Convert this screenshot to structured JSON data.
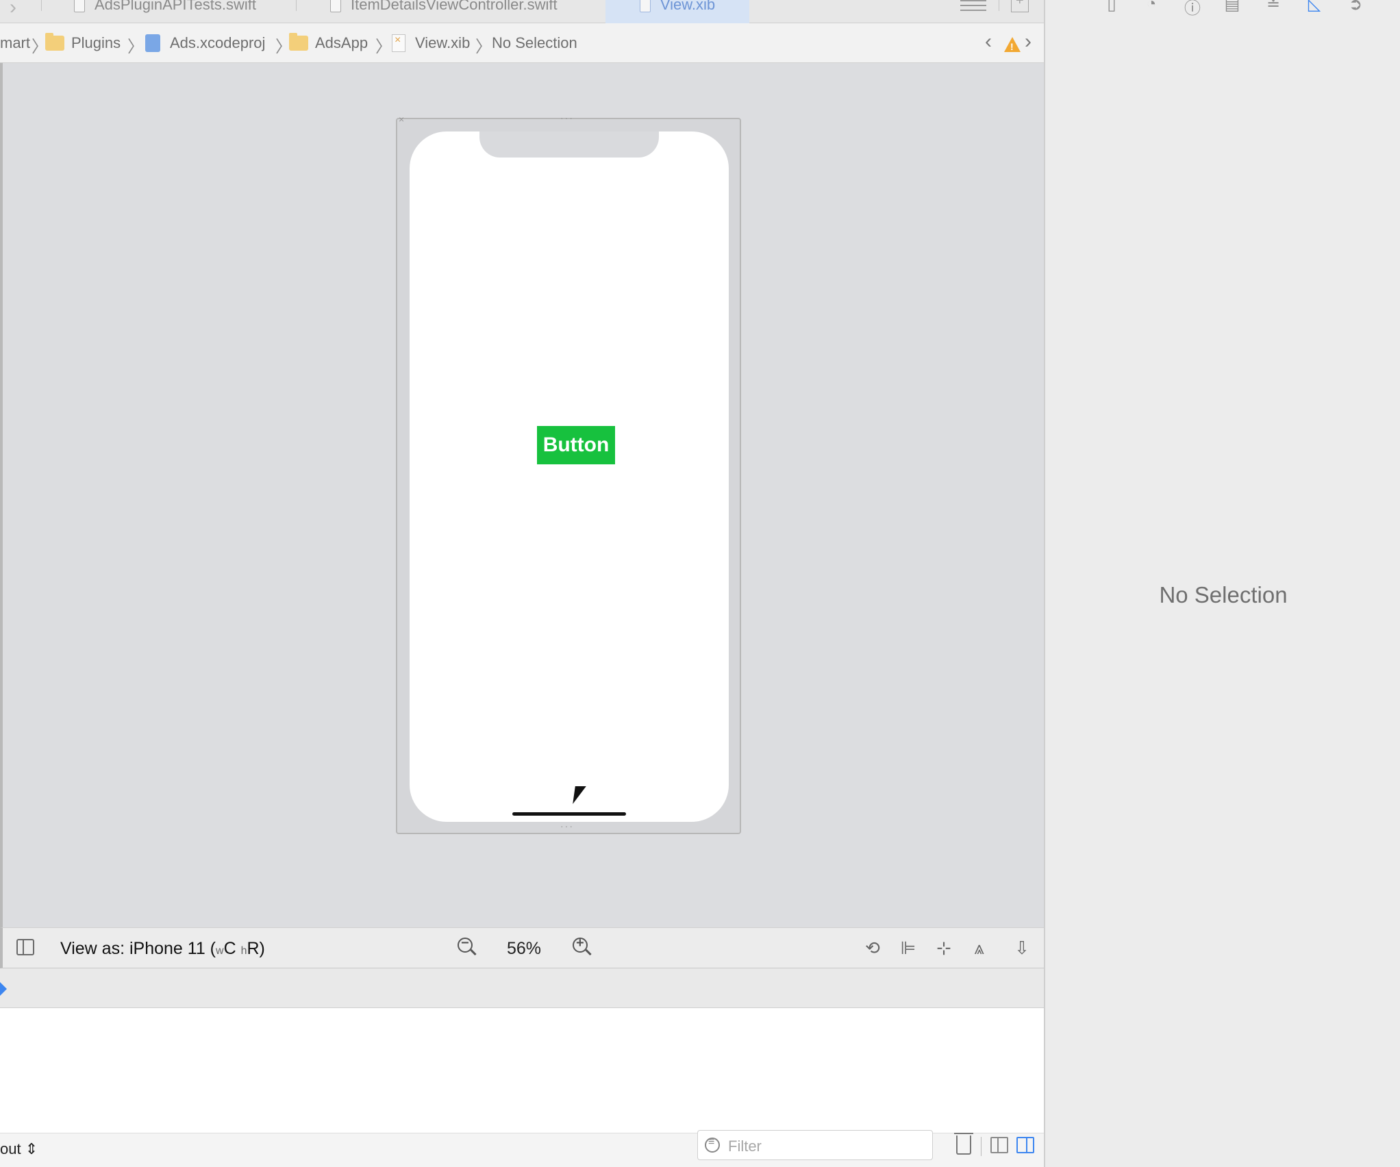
{
  "tabs": [
    {
      "label": "AdsPluginAPITests.swift",
      "active": false,
      "icon": "swift-file-icon"
    },
    {
      "label": "ItemDetailsViewController.swift",
      "active": false,
      "icon": "swift-file-icon"
    },
    {
      "label": "View.xib",
      "active": true,
      "icon": "xib-file-icon"
    }
  ],
  "breadcrumb": {
    "items": [
      "mart",
      "Plugins",
      "Ads.xcodeproj",
      "AdsApp",
      "View.xib",
      "No Selection"
    ]
  },
  "canvas": {
    "button_label": "Button",
    "device_label": "View as: iPhone 11 (",
    "size_class_w": "w",
    "size_class_c": "C",
    "size_class_h": "h",
    "size_class_r": "R)",
    "zoom": "56%"
  },
  "console": {
    "output_label": "out",
    "filter_placeholder": "Filter"
  },
  "inspector": {
    "empty_label": "No Selection"
  },
  "colors": {
    "accent": "#3d86f0",
    "button_bg": "#17c13e",
    "warning": "#f2a832"
  }
}
